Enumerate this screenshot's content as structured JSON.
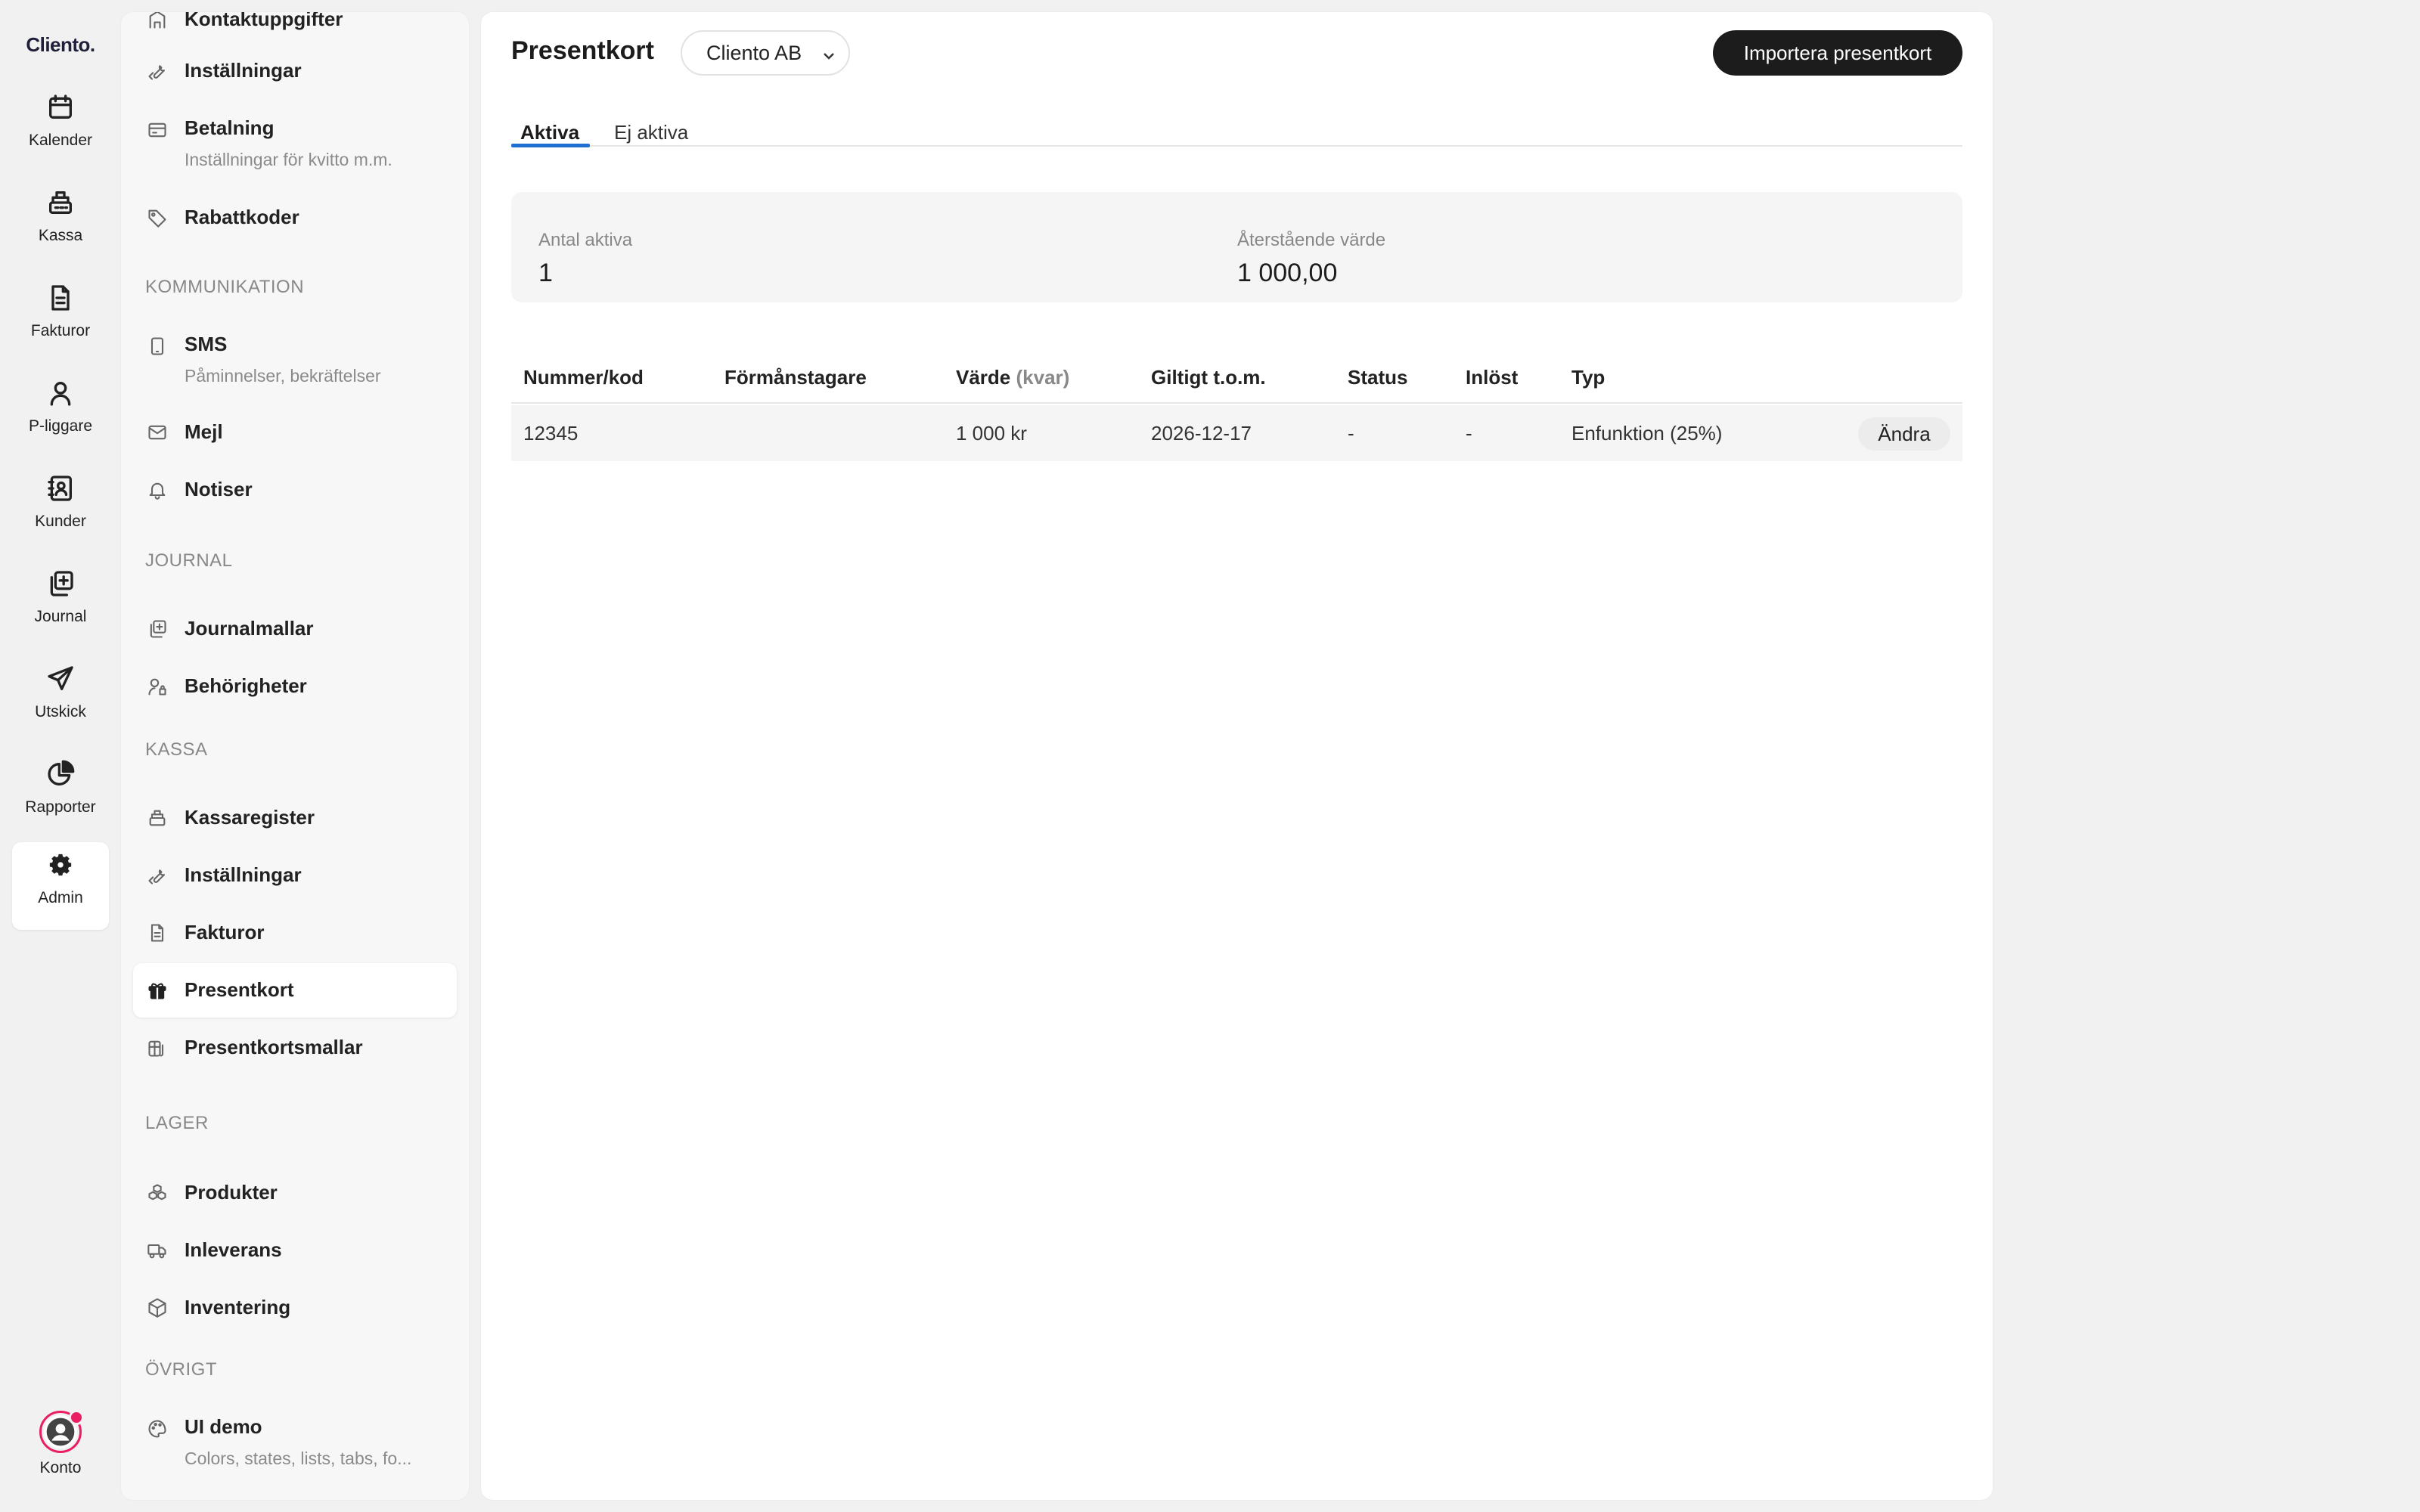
{
  "app": {
    "logo": "Cliento."
  },
  "rail": {
    "items": [
      {
        "label": "Kalender",
        "icon": "calendar-icon"
      },
      {
        "label": "Kassa",
        "icon": "cash-register-icon"
      },
      {
        "label": "Fakturor",
        "icon": "document-icon"
      },
      {
        "label": "P-liggare",
        "icon": "person-icon"
      },
      {
        "label": "Kunder",
        "icon": "contact-card-icon"
      },
      {
        "label": "Journal",
        "icon": "journal-icon"
      },
      {
        "label": "Utskick",
        "icon": "send-icon"
      },
      {
        "label": "Rapporter",
        "icon": "pie-chart-icon"
      },
      {
        "label": "Admin",
        "icon": "gear-icon",
        "active": true
      }
    ],
    "account": {
      "label": "Konto"
    }
  },
  "sidebar": {
    "top_items": [
      {
        "title": "Kontaktuppgifter"
      },
      {
        "title": "Inställningar"
      },
      {
        "title": "Betalning",
        "sub": "Inställningar för kvitto m.m."
      },
      {
        "title": "Rabattkoder"
      }
    ],
    "sections": {
      "kommunikation": "KOMMUNIKATION",
      "journal": "JOURNAL",
      "kassa": "KASSA",
      "lager": "LAGER",
      "ovrigt": "ÖVRIGT"
    },
    "kommunikation_items": [
      {
        "title": "SMS",
        "sub": "Påminnelser, bekräftelser"
      },
      {
        "title": "Mejl"
      },
      {
        "title": "Notiser"
      }
    ],
    "journal_items": [
      {
        "title": "Journalmallar"
      },
      {
        "title": "Behörigheter"
      }
    ],
    "kassa_items": [
      {
        "title": "Kassaregister"
      },
      {
        "title": "Inställningar"
      },
      {
        "title": "Fakturor"
      },
      {
        "title": "Presentkort",
        "active": true
      },
      {
        "title": "Presentkortsmallar"
      }
    ],
    "lager_items": [
      {
        "title": "Produkter"
      },
      {
        "title": "Inleverans"
      },
      {
        "title": "Inventering"
      }
    ],
    "ovrigt_items": [
      {
        "title": "UI demo",
        "sub": "Colors, states, lists, tabs, fo..."
      }
    ]
  },
  "main": {
    "title": "Presentkort",
    "org_select": {
      "value": "Cliento AB"
    },
    "import_label": "Importera presentkort",
    "tabs": [
      {
        "label": "Aktiva",
        "active": true
      },
      {
        "label": "Ej aktiva"
      }
    ],
    "stats": {
      "active_count_label": "Antal aktiva",
      "active_count_value": "1",
      "remaining_label": "Återstående värde",
      "remaining_value": "1 000,00"
    },
    "table": {
      "headers": {
        "number": "Nummer/kod",
        "beneficiary": "Förmånstagare",
        "value": "Värde",
        "value_hint": "(kvar)",
        "valid": "Giltigt t.o.m.",
        "status": "Status",
        "redeemed": "Inlöst",
        "type": "Typ"
      },
      "rows": [
        {
          "number": "12345",
          "beneficiary": "",
          "value": "1 000 kr",
          "valid": "2026-12-17",
          "status": "-",
          "redeemed": "-",
          "type": "Enfunktion (25%)",
          "edit_label": "Ändra"
        }
      ]
    }
  }
}
